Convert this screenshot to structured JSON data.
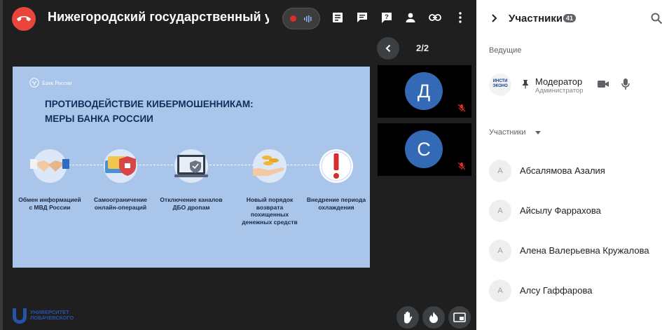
{
  "meeting": {
    "title": "Нижегородский государственный универ",
    "pager": "2/2"
  },
  "slide": {
    "bank_name": "Банк России",
    "title_line1": "ПРОТИВОДЕЙСТВИЕ КИБЕРМОШЕННИКАМ:",
    "title_line2": "МЕРЫ БАНКА РОССИИ",
    "measures": [
      {
        "icon": "handshake-icon",
        "caption": "Обмен информацией с МВД России"
      },
      {
        "icon": "credit-cards-icon",
        "caption": "Самоограничение онлайн-операций"
      },
      {
        "icon": "laptop-shield-icon",
        "caption": "Отключение каналов ДБО дропам"
      },
      {
        "icon": "coins-hand-icon",
        "caption": "Новый порядок возврата похищенных денежных средств"
      },
      {
        "icon": "exclamation-icon",
        "caption": "Внедрение периода охлаждения"
      }
    ]
  },
  "thumbs": [
    {
      "initial": "Д"
    },
    {
      "initial": "С"
    }
  ],
  "university_logo": {
    "line1": "УНИВЕРСИТЕТ",
    "line2": "ЛОБАЧЕВСКОГО"
  },
  "sidebar": {
    "title": "Участники",
    "count": "41",
    "hosts_label": "Ведущие",
    "moderator": {
      "logo_line1": "ИНСТИ",
      "logo_line2": "ЭКОНО",
      "name": "Модератор",
      "role": "Администратор"
    },
    "participants_label": "Участники",
    "participants": [
      {
        "initial": "А",
        "name": "Абсалямова Азалия"
      },
      {
        "initial": "А",
        "name": "Айсылу Фаррахова"
      },
      {
        "initial": "А",
        "name": "Алена Валерьевна Кружалова"
      },
      {
        "initial": "А",
        "name": "Алсу Гаффарова"
      }
    ]
  },
  "colors": {
    "leave": "#e8453c",
    "record": "#d93025",
    "slide_bg": "#a9c5ea",
    "avatar_blue": "#3469b5"
  }
}
